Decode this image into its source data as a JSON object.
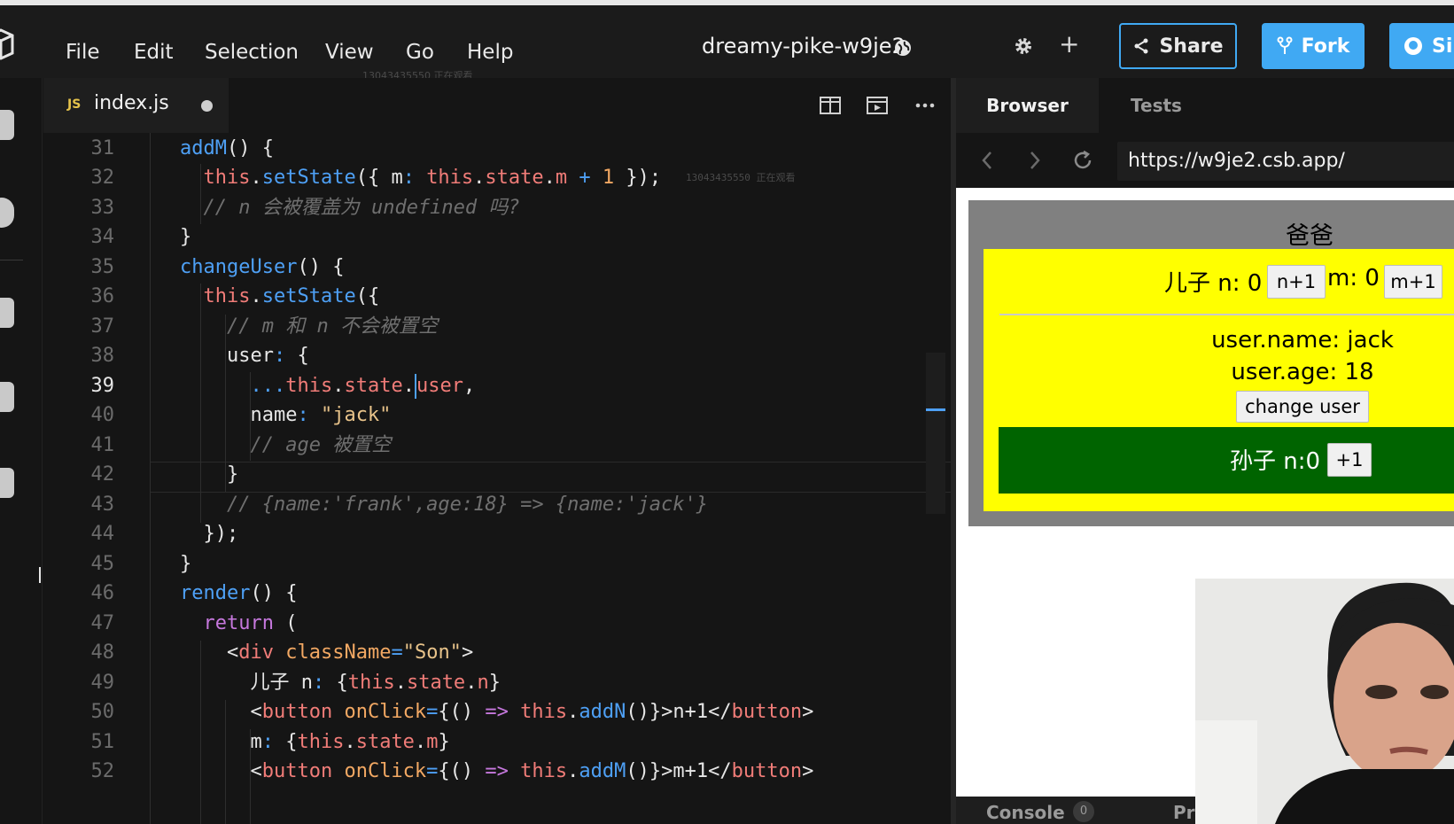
{
  "menubar": {
    "items": [
      "File",
      "Edit",
      "Selection",
      "View",
      "Go",
      "Help"
    ],
    "project_title": "dreamy-pike-w9je2",
    "share_label": "Share",
    "fork_label": "Fork",
    "github_label": "Si",
    "watermark": "13043435550 正在观看"
  },
  "editor": {
    "tab_badge": "JS",
    "tab_name": "index.js",
    "watermark": "13043435550 正在观看",
    "line_numbers": [
      "31",
      "32",
      "33",
      "34",
      "35",
      "36",
      "37",
      "38",
      "39",
      "40",
      "41",
      "42",
      "43",
      "44",
      "45",
      "46",
      "47",
      "48",
      "49",
      "50",
      "51",
      "52"
    ],
    "active_line": "39"
  },
  "preview": {
    "tab_browser": "Browser",
    "tab_tests": "Tests",
    "url": "https://w9je2.csb.app/",
    "papa_title": "爸爸",
    "son_label_n": "儿子 n: 0",
    "n_plus_button": "n+1",
    "son_label_m": "m: 0",
    "m_plus_button": "m+1",
    "user_name": "user.name: jack",
    "user_age": "user.age: 18",
    "change_user_button": "change user",
    "grandson_label": "孙子 n:0",
    "grandson_plus_button": "+1",
    "console_label": "Console",
    "console_count": "0",
    "problems_label": "Pro"
  },
  "colors": {
    "accent": "#40a9f3",
    "son_bg": "#ffff00",
    "grandson_bg": "#006400",
    "papa_bg": "#808080"
  }
}
